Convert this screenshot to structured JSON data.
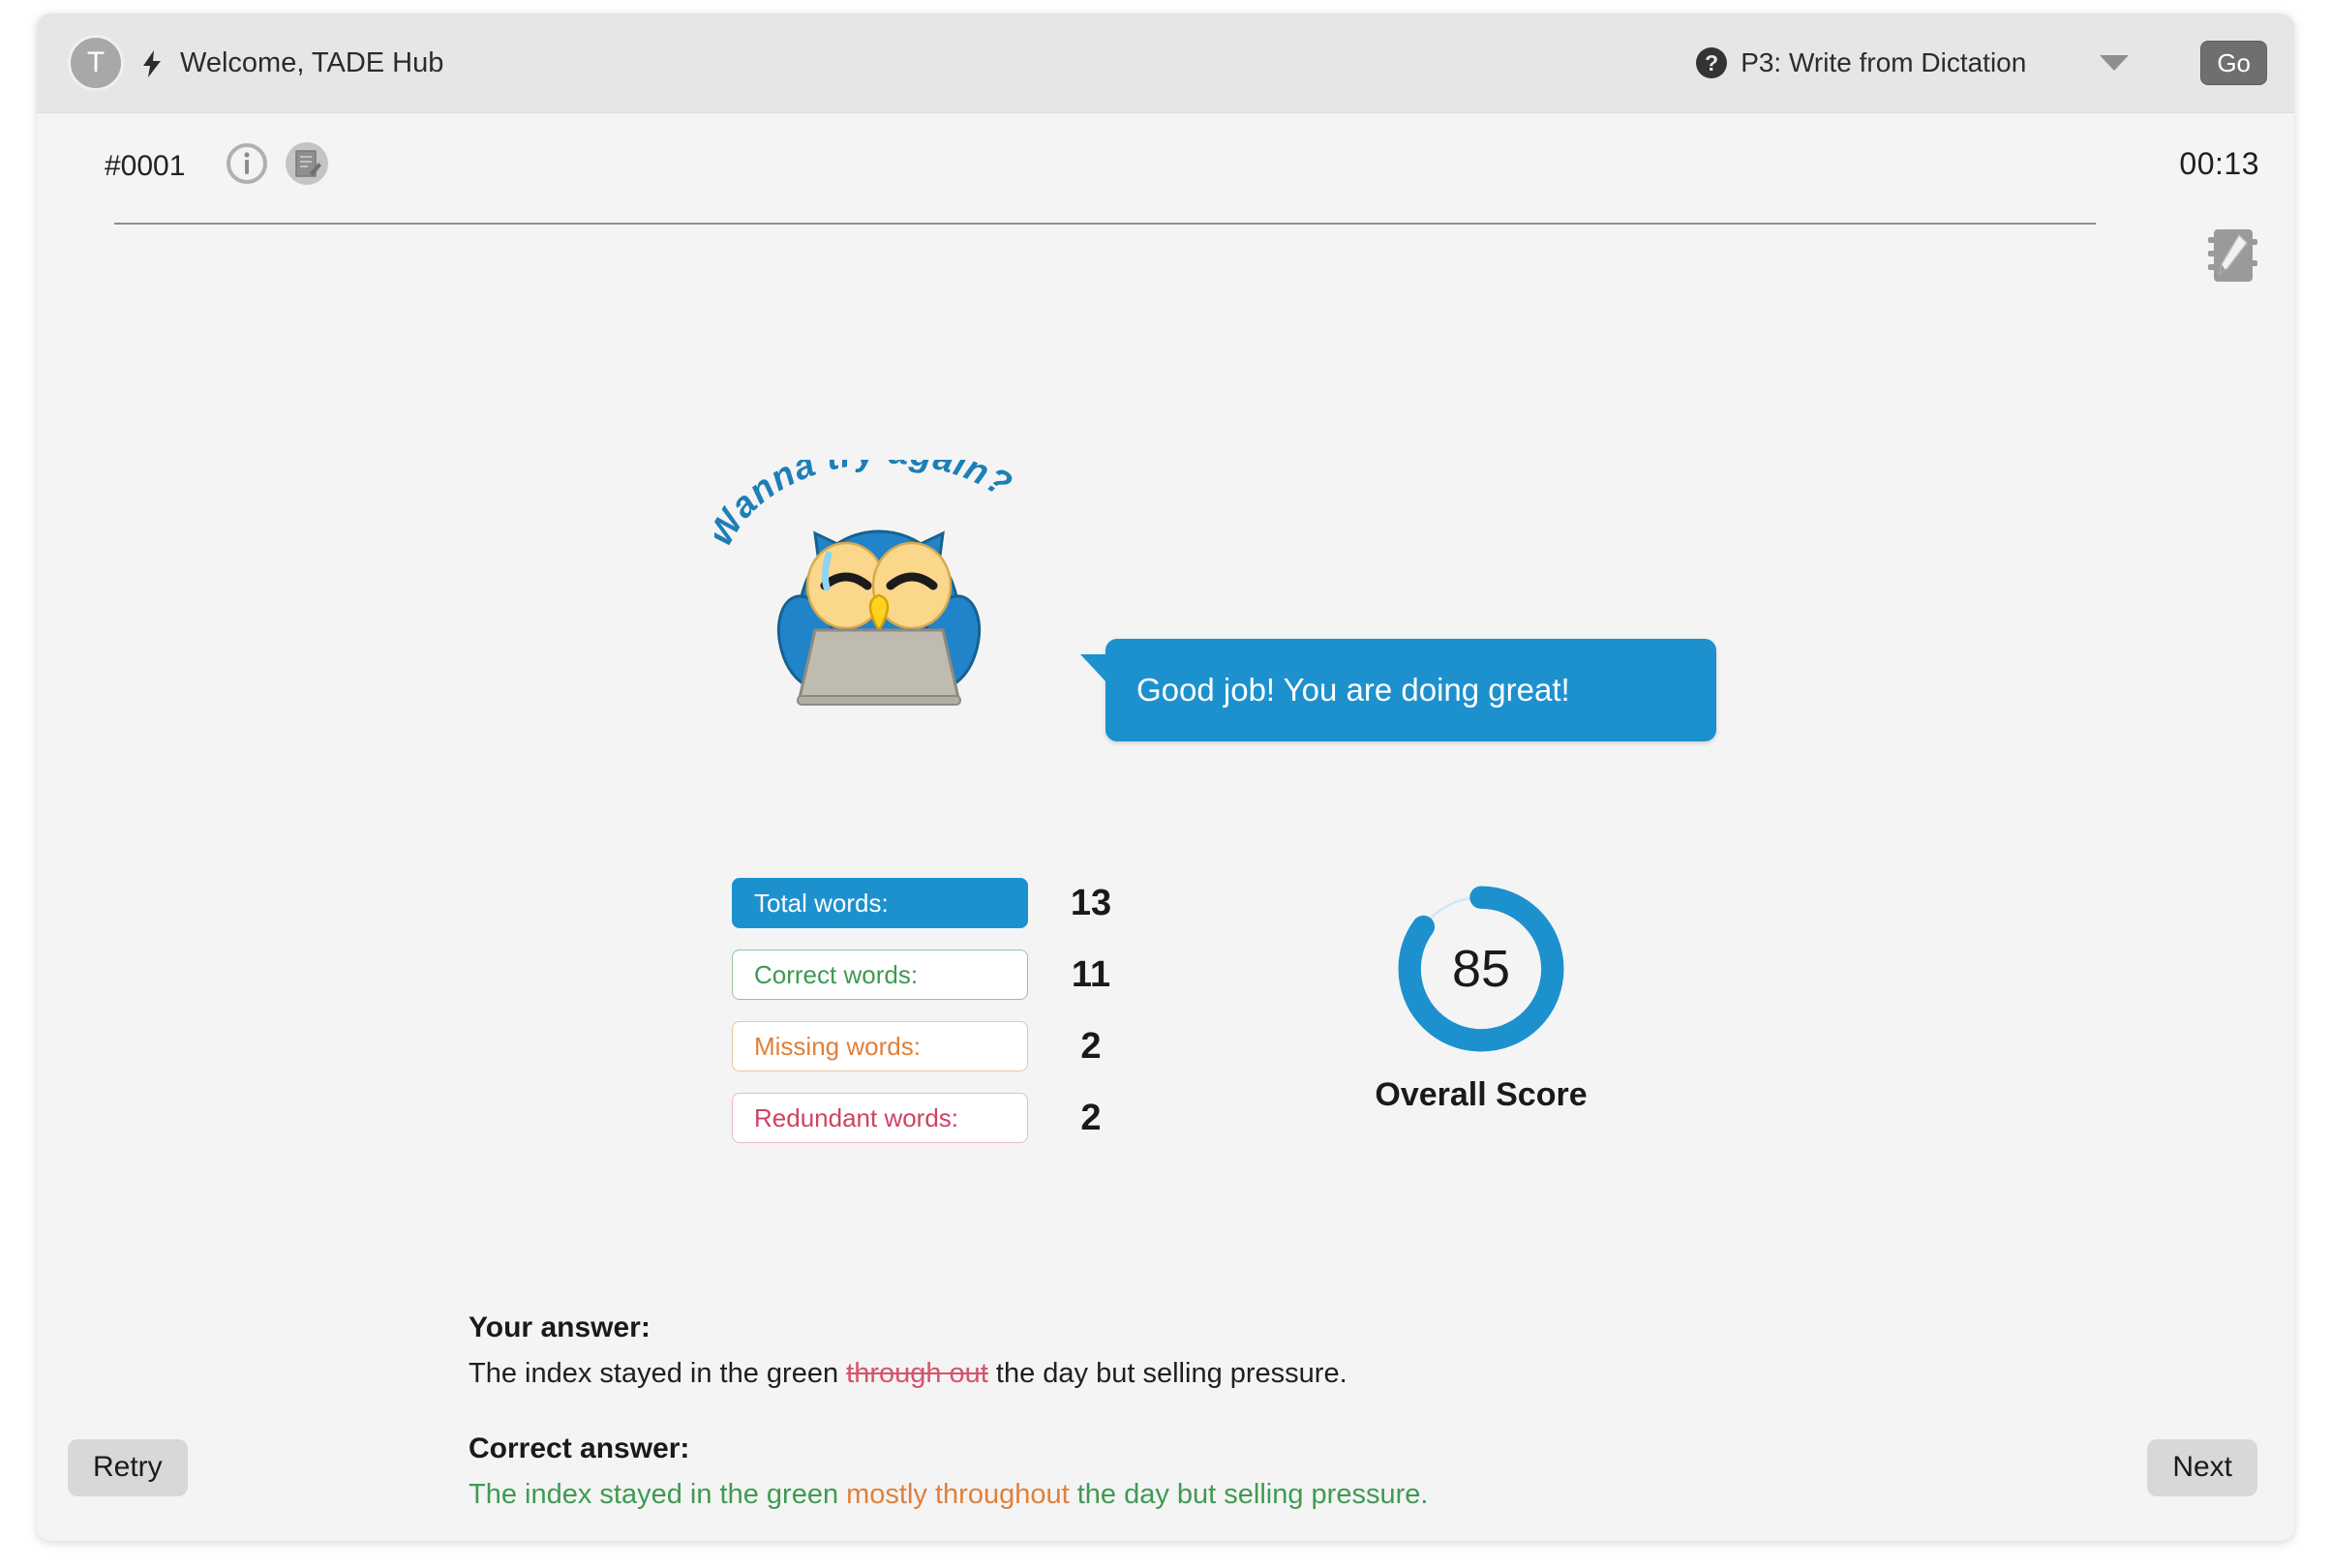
{
  "header": {
    "avatar_initial": "T",
    "bolt_icon": "lightning-bolt-icon",
    "welcome_text": "Welcome, TADE Hub",
    "help_icon": "question-mark-icon",
    "task_selected": "P3: Write from Dictation",
    "dropdown_icon": "chevron-down-icon",
    "go_label": "Go"
  },
  "toolbar": {
    "item_number": "#0001",
    "info_icon": "info-icon",
    "note_icon": "note-edit-icon",
    "timer": "00:13",
    "notebook_icon": "notebook-pencil-icon"
  },
  "mascot": {
    "headline": "Wanna try again?",
    "bubble_text": "Good job! You are doing great!",
    "owl_icon": "owl-with-laptop-icon"
  },
  "stats": [
    {
      "label": "Total words:",
      "value": "13",
      "style": "total"
    },
    {
      "label": "Correct words:",
      "value": "11",
      "style": "correct"
    },
    {
      "label": "Missing words:",
      "value": "2",
      "style": "missing"
    },
    {
      "label": "Redundant words:",
      "value": "2",
      "style": "redundant"
    }
  ],
  "score": {
    "value": "85",
    "label": "Overall Score",
    "percent": 85,
    "ring_color": "#1d91ce",
    "track_color": "#cfe6f4"
  },
  "answers": {
    "your_answer_heading": "Your answer:",
    "your_answer_part1": "The index stayed in the green ",
    "your_answer_strike": "through out",
    "your_answer_part2": " the day but selling pressure.",
    "correct_answer_heading": "Correct answer:",
    "correct_part1": "The index stayed in the green ",
    "correct_missing": "mostly throughout",
    "correct_part2": " the day but selling pressure."
  },
  "footer": {
    "retry_label": "Retry",
    "next_label": "Next"
  },
  "colors": {
    "accent_blue": "#1d91ce",
    "green": "#3f9a52",
    "orange": "#e0803a",
    "red": "#cf4263"
  }
}
